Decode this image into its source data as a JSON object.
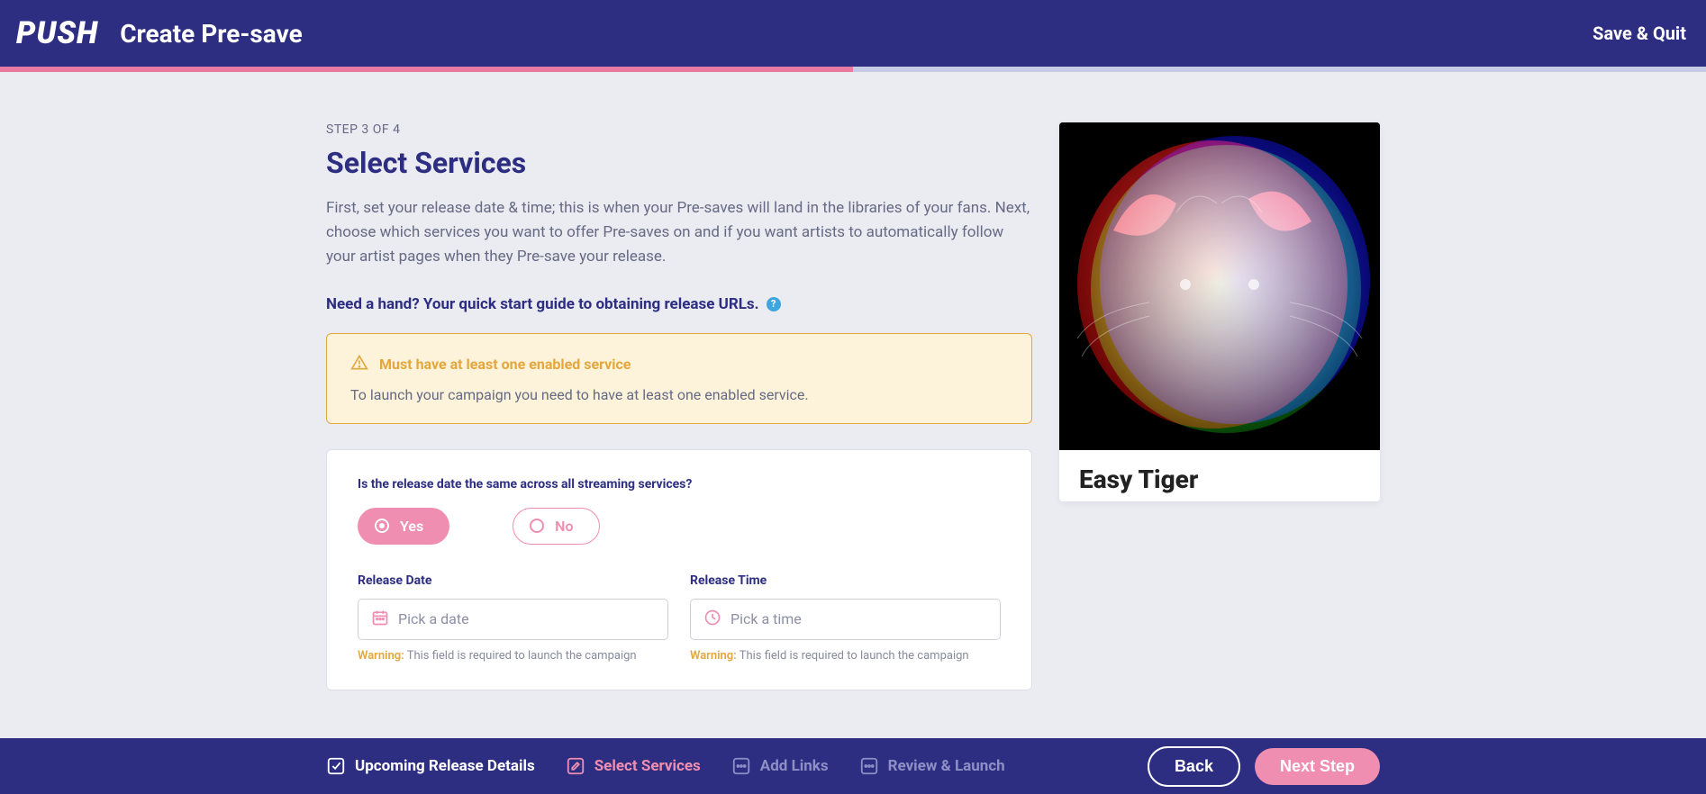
{
  "header": {
    "logo": "PUSH",
    "title": "Create Pre-save",
    "save_quit": "Save & Quit"
  },
  "progress": {
    "percent": 50
  },
  "step": {
    "label": "STEP 3 OF 4",
    "title": "Select Services"
  },
  "description": "First, set your release date & time; this is when your Pre-saves will land in the libraries of your fans. Next, choose which services you want to offer Pre-saves on and if you want artists to automatically follow your artist pages when they Pre-save your release.",
  "help": {
    "text": "Need a hand? Your quick start guide to obtaining release URLs.",
    "icon": "?"
  },
  "warning": {
    "title": "Must have at least one enabled service",
    "body": "To launch your campaign you need to have at least one enabled service."
  },
  "form": {
    "question": "Is the release date the same across all streaming services?",
    "yes": "Yes",
    "no": "No",
    "release_date_label": "Release Date",
    "release_date_placeholder": "Pick a date",
    "release_time_label": "Release Time",
    "release_time_placeholder": "Pick a time",
    "field_warning_label": "Warning:",
    "field_warning_text": "This field is required to launch the campaign"
  },
  "preview": {
    "title": "Easy Tiger"
  },
  "footer": {
    "steps": [
      {
        "label": "Upcoming Release Details",
        "state": "done"
      },
      {
        "label": "Select Services",
        "state": "active"
      },
      {
        "label": "Add Links",
        "state": "pending"
      },
      {
        "label": "Review & Launch",
        "state": "pending"
      }
    ],
    "back": "Back",
    "next": "Next Step"
  }
}
